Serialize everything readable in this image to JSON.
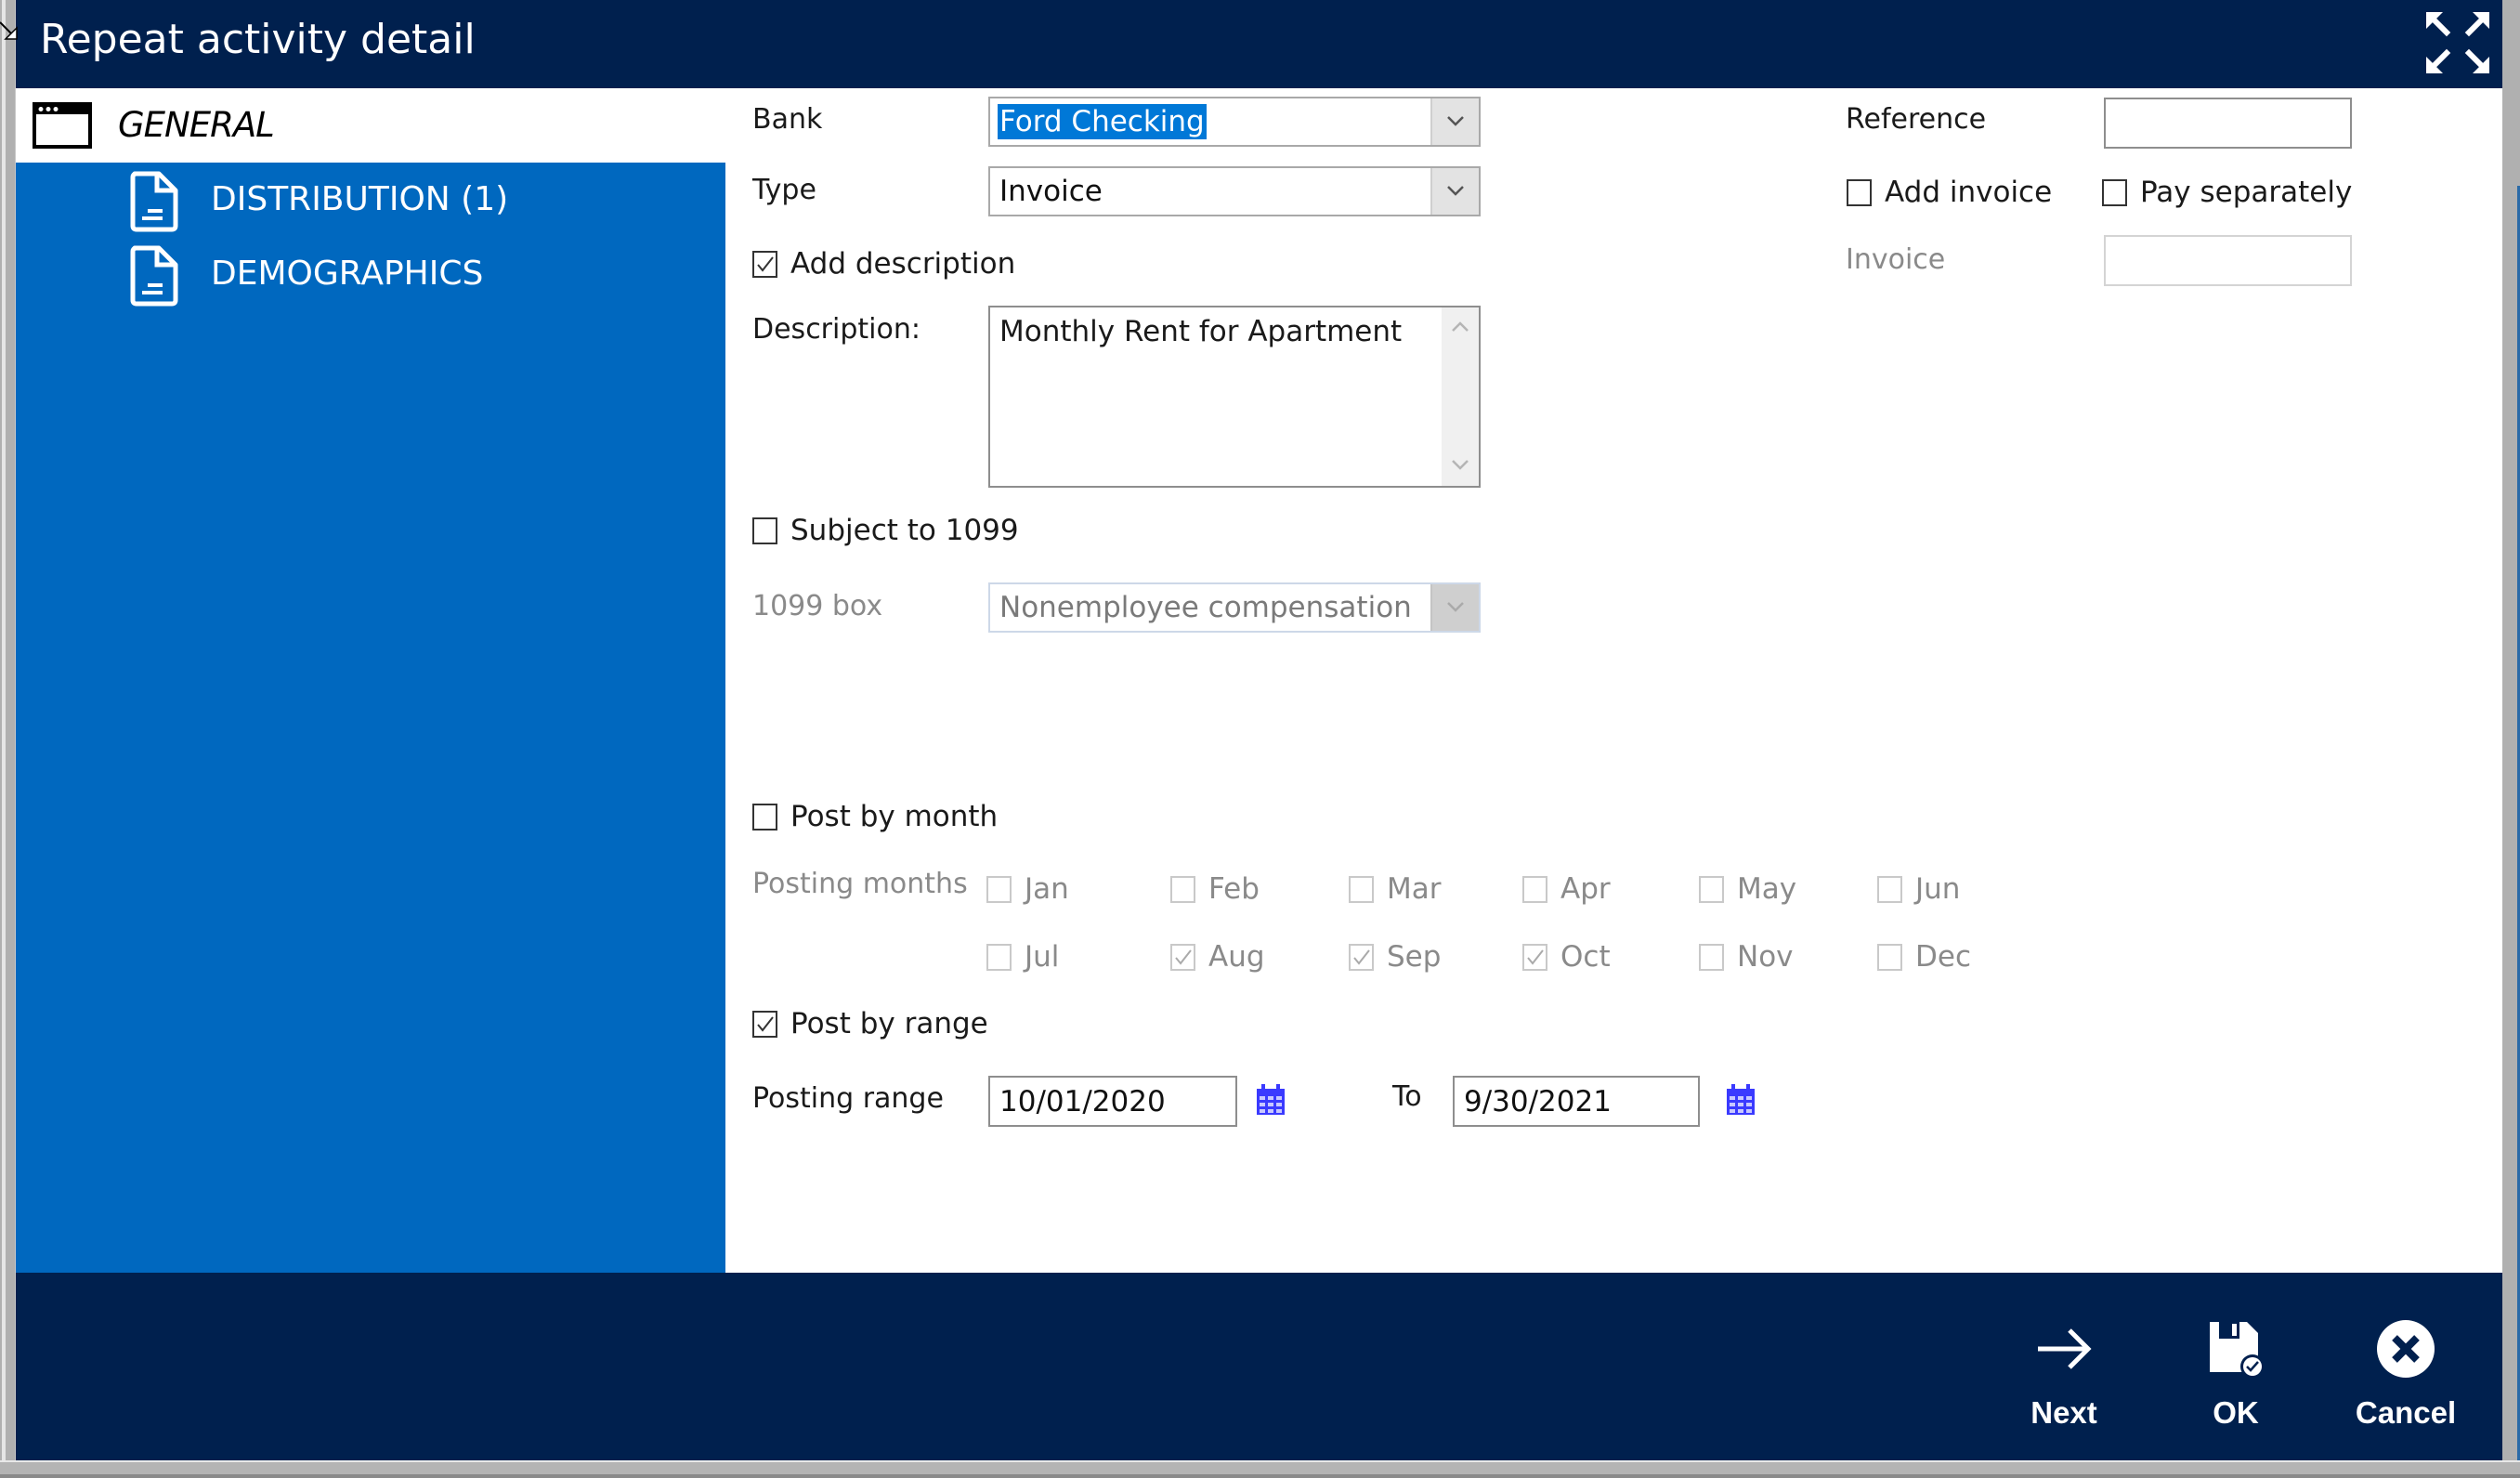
{
  "window": {
    "title": "Repeat activity detail",
    "expand_icon": "expand-arrows-icon"
  },
  "sidebar": {
    "items": [
      {
        "label": "GENERAL",
        "icon": "window-icon",
        "selected": true
      },
      {
        "label": "DISTRIBUTION (1)",
        "icon": "document-icon",
        "selected": false
      },
      {
        "label": "DEMOGRAPHICS",
        "icon": "document-icon",
        "selected": false
      }
    ]
  },
  "form": {
    "bank": {
      "label": "Bank",
      "value": "Ford Checking"
    },
    "type": {
      "label": "Type",
      "value": "Invoice"
    },
    "add_description": {
      "label": "Add description",
      "checked": true
    },
    "description": {
      "label": "Description:",
      "value": "Monthly Rent for Apartment"
    },
    "subject_1099": {
      "label": "Subject to 1099",
      "checked": false
    },
    "box_1099": {
      "label": "1099 box",
      "value": "Nonemployee compensation",
      "disabled": true
    },
    "reference": {
      "label": "Reference",
      "value": ""
    },
    "add_invoice": {
      "label": "Add invoice",
      "checked": false
    },
    "pay_separately": {
      "label": "Pay separately",
      "checked": false
    },
    "invoice": {
      "label": "Invoice",
      "value": "",
      "disabled": true
    },
    "post_by_month": {
      "label": "Post by month",
      "checked": false
    },
    "posting_months": {
      "label": "Posting months",
      "months": [
        {
          "label": "Jan",
          "checked": false
        },
        {
          "label": "Feb",
          "checked": false
        },
        {
          "label": "Mar",
          "checked": false
        },
        {
          "label": "Apr",
          "checked": false
        },
        {
          "label": "May",
          "checked": false
        },
        {
          "label": "Jun",
          "checked": false
        },
        {
          "label": "Jul",
          "checked": false
        },
        {
          "label": "Aug",
          "checked": true
        },
        {
          "label": "Sep",
          "checked": true
        },
        {
          "label": "Oct",
          "checked": true
        },
        {
          "label": "Nov",
          "checked": false
        },
        {
          "label": "Dec",
          "checked": false
        }
      ]
    },
    "post_by_range": {
      "label": "Post by range",
      "checked": true
    },
    "posting_range": {
      "label": "Posting range",
      "from": "10/01/2020",
      "to_label": "To",
      "to": "9/30/2021"
    }
  },
  "footer": {
    "buttons": [
      {
        "label": "Next",
        "icon": "arrow-right-icon"
      },
      {
        "label": "OK",
        "icon": "save-check-icon"
      },
      {
        "label": "Cancel",
        "icon": "cancel-circle-icon"
      }
    ]
  },
  "colors": {
    "header_bg": "#00204e",
    "sidebar_bg": "#0068bf",
    "selection": "#0078d7",
    "calendar_icon": "#3a3aff"
  }
}
